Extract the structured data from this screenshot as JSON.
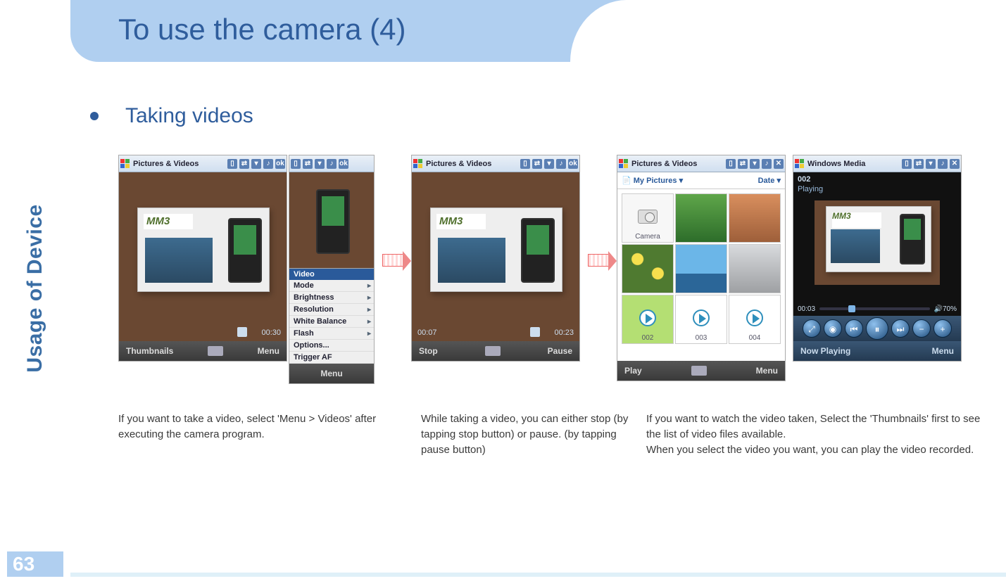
{
  "page": {
    "number": "63",
    "sidebar_label": "Usage of Device",
    "title": "To use the camera (4)",
    "section_bullet": "Taking videos"
  },
  "shot1": {
    "titlebar": "Pictures & Videos",
    "tb_ok": "ok",
    "timer_right": "00:30",
    "soft_left": "Thumbnails",
    "soft_right": "Menu",
    "vf_brand": "MM3"
  },
  "shot1_menu": {
    "tb_ok": "ok",
    "header": "Video",
    "items": [
      "Mode",
      "Brightness",
      "Resolution",
      "White Balance",
      "Flash",
      "Options...",
      "Trigger AF"
    ],
    "soft": "Menu"
  },
  "shot2": {
    "titlebar": "Pictures & Videos",
    "tb_ok": "ok",
    "timer_left": "00:07",
    "timer_right": "00:23",
    "soft_left": "Stop",
    "soft_right": "Pause",
    "vf_brand": "MM3"
  },
  "shot3": {
    "titlebar": "Pictures & Videos",
    "tb_close": "✕",
    "folder_label": "My Pictures",
    "sort_label": "Date",
    "camera_label": "Camera",
    "video_labels": [
      "002",
      "003",
      "004"
    ],
    "soft_left": "Play",
    "soft_right": "Menu"
  },
  "shot4": {
    "titlebar": "Windows Media",
    "tb_close": "✕",
    "track_title": "002",
    "status": "Playing",
    "time_elapsed": "00:03",
    "volume": "70%",
    "vf_brand": "MM3",
    "soft_left": "Now Playing",
    "soft_right": "Menu"
  },
  "captions": {
    "c1": "If you want to take a video, select 'Menu > Videos' after executing the camera program.",
    "c2": "While taking a video, you can either stop (by tapping stop button) or pause. (by tapping pause button)",
    "c3a": "If you want to watch the video taken, Select the 'Thumbnails' first to see the list of video files available.",
    "c3b": "When you select the video you want, you can play the video recorded."
  }
}
